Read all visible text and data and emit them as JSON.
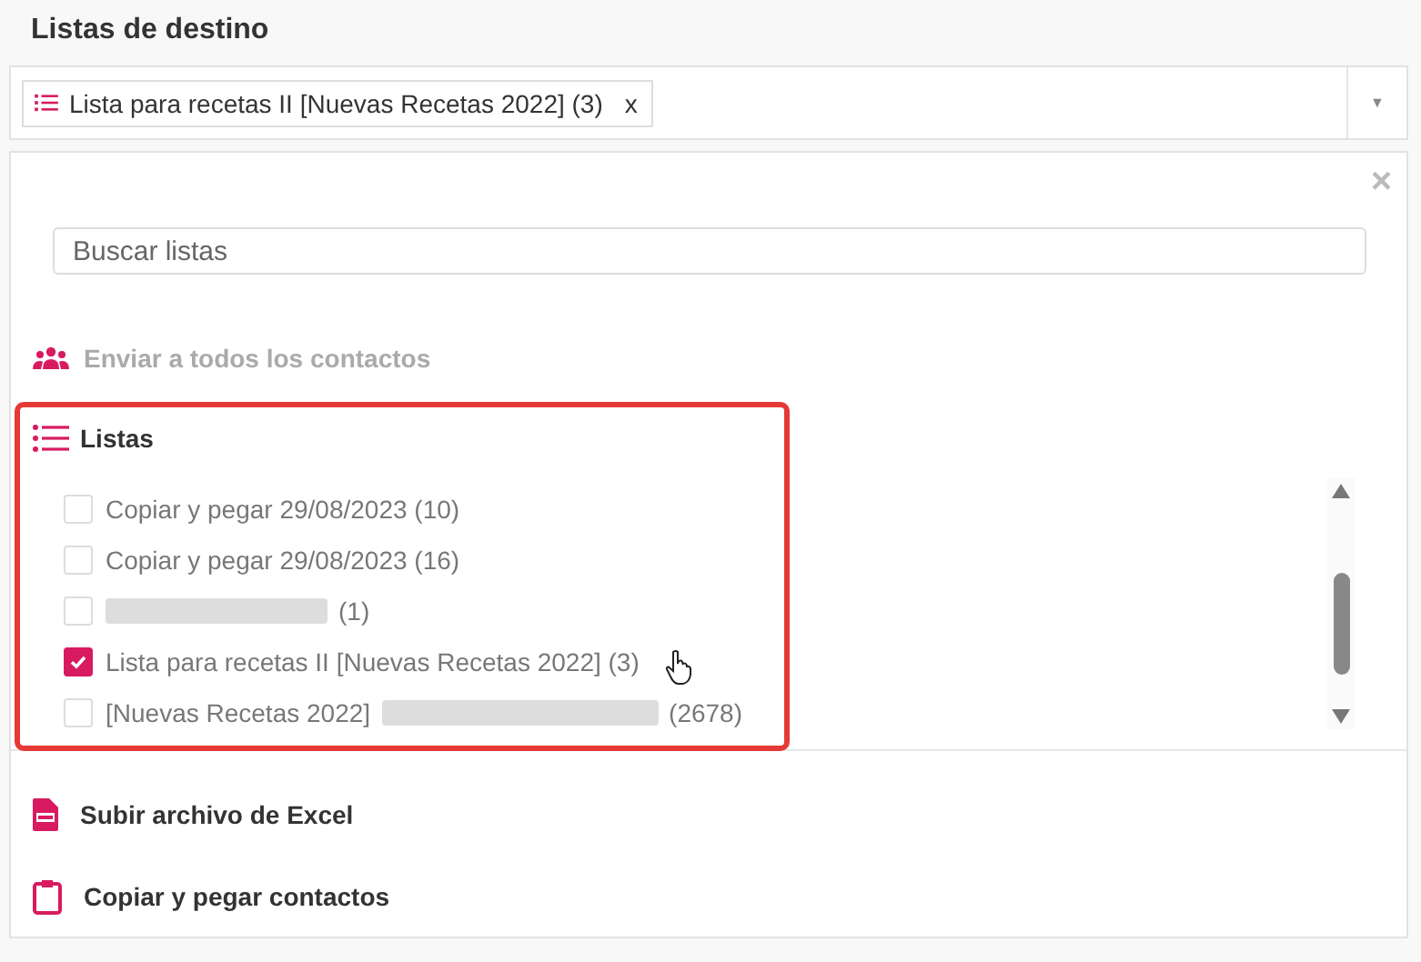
{
  "title": "Listas de destino",
  "select": {
    "chips": [
      {
        "label": "Lista para recetas II [Nuevas Recetas 2022] (3)",
        "remove": "x"
      }
    ],
    "caret": "▼"
  },
  "panel": {
    "close": "×",
    "search": {
      "placeholder": "Buscar listas"
    },
    "all_contacts": {
      "label": "Enviar a todos los contactos",
      "disabled": true
    },
    "lists": {
      "label": "Listas",
      "highlighted": true,
      "items": [
        {
          "label": "Copiar y pegar 29/08/2023 (10)",
          "checked": false,
          "redacted": false
        },
        {
          "label": "Copiar y pegar 29/08/2023 (16)",
          "checked": false,
          "redacted": false
        },
        {
          "count": "(1)",
          "checked": false,
          "redacted": true
        },
        {
          "label": "Lista para recetas II [Nuevas Recetas 2022] (3)",
          "checked": true,
          "redacted": false
        },
        {
          "label": "[Nuevas Recetas 2022]",
          "count": "(2678)",
          "checked": false,
          "redacted": true
        }
      ]
    },
    "actions": [
      {
        "kind": "excel",
        "label": "Subir archivo de Excel"
      },
      {
        "kind": "paste",
        "label": "Copiar y pegar contactos"
      }
    ]
  }
}
